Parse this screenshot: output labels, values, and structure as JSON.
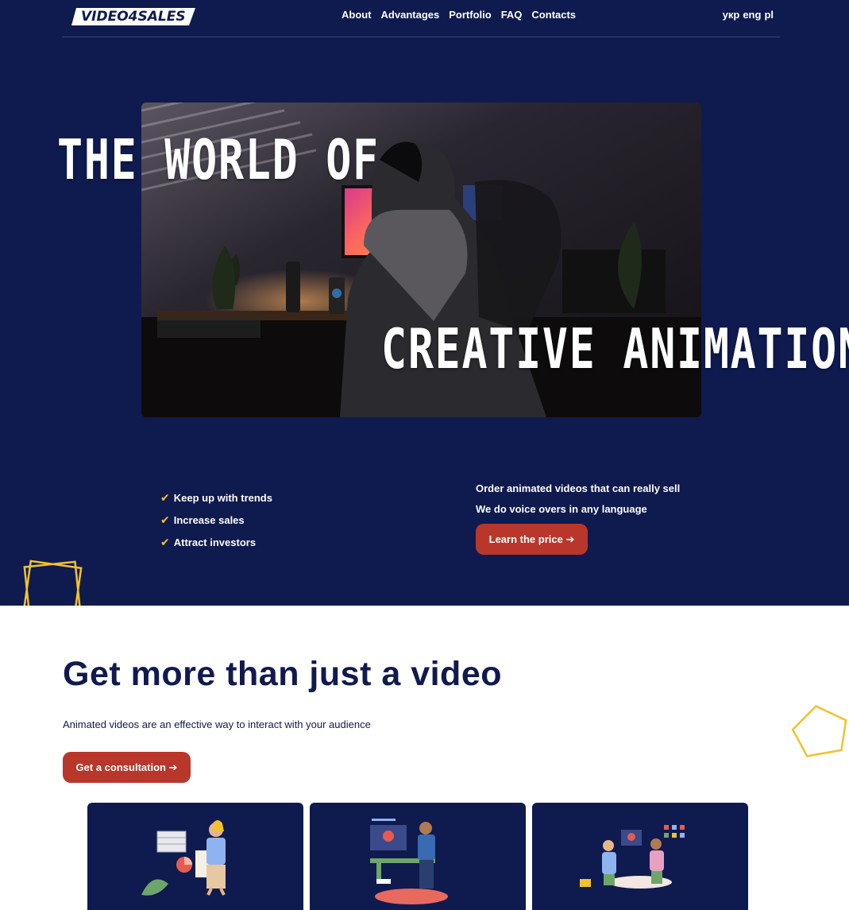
{
  "logo": {
    "text": "VIDEO4SALES"
  },
  "nav": {
    "items": [
      "About",
      "Advantages",
      "Portfolio",
      "FAQ",
      "Contacts"
    ]
  },
  "langs": [
    "укр",
    "eng",
    "pl"
  ],
  "hero": {
    "title_line1": "THE WORLD OF",
    "title_line2": "CREATIVE ANIMATION",
    "bullets": [
      "Keep up with trends",
      "Increase sales",
      "Attract investors"
    ],
    "check_mark": "✔",
    "order_line1": "Order animated videos that can really sell",
    "order_line2": "We do voice overs in any language",
    "price_button": "Learn the price ➔"
  },
  "section2": {
    "title": "Get more than just a video",
    "subtitle": "Animated videos are an effective way to interact with your audience",
    "consult_button": "Get a consultation ➔"
  },
  "colors": {
    "navy": "#0f1a4f",
    "accent_red": "#b9372a",
    "deco_yellow": "#f2c12e",
    "title_navy": "#101a4e"
  }
}
